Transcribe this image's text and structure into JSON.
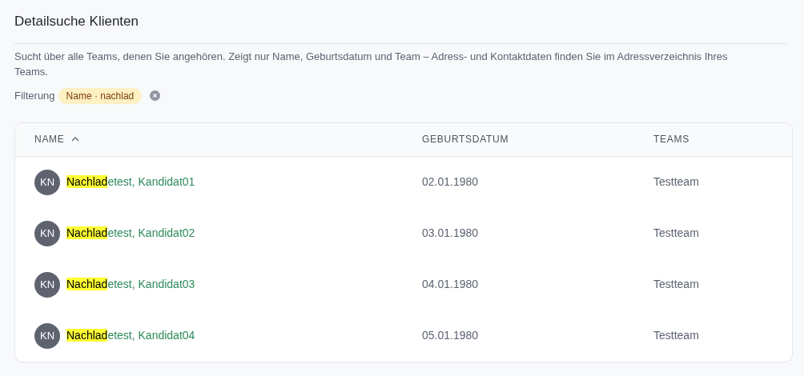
{
  "title": "Detailsuche Klienten",
  "description": "Sucht über alle Teams, denen Sie angehören. Zeigt nur Name, Geburtsdatum und Team – Adress- und Kontaktdaten finden Sie im Adressverzeichnis Ihres Teams.",
  "filter": {
    "label": "Filterung",
    "chip": "Name · nachlad"
  },
  "table": {
    "columns": [
      {
        "label": "NAME",
        "sorted": true
      },
      {
        "label": "GEBURTSDATUM",
        "sorted": false
      },
      {
        "label": "TEAMS",
        "sorted": false
      }
    ],
    "rows": [
      {
        "initials": "KN",
        "name_match": "Nachlad",
        "name_rest": "etest, Kandidat01",
        "birthdate": "02.01.1980",
        "teams": "Testteam"
      },
      {
        "initials": "KN",
        "name_match": "Nachlad",
        "name_rest": "etest, Kandidat02",
        "birthdate": "03.01.1980",
        "teams": "Testteam"
      },
      {
        "initials": "KN",
        "name_match": "Nachlad",
        "name_rest": "etest, Kandidat03",
        "birthdate": "04.01.1980",
        "teams": "Testteam"
      },
      {
        "initials": "KN",
        "name_match": "Nachlad",
        "name_rest": "etest, Kandidat04",
        "birthdate": "05.01.1980",
        "teams": "Testteam"
      }
    ]
  }
}
